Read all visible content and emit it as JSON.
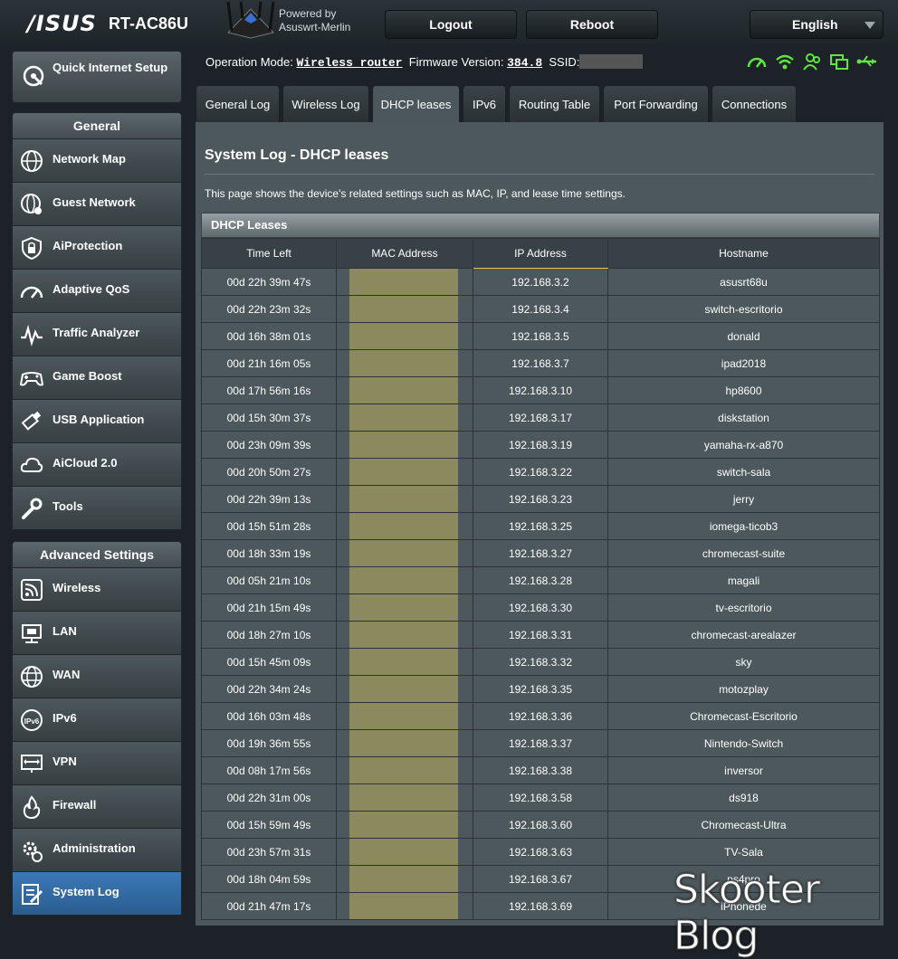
{
  "header": {
    "brand": "/ISUS",
    "model": "RT-AC86U",
    "powered_by": "Powered by",
    "firmware_name": "Asuswrt-Merlin",
    "logout_label": "Logout",
    "reboot_label": "Reboot",
    "language": "English"
  },
  "status": {
    "op_mode_label": "Operation Mode:",
    "op_mode_value": "Wireless router",
    "fw_label": "Firmware Version:",
    "fw_value": "384.8",
    "ssid_label": "SSID:",
    "icons": [
      "speedometer-icon",
      "wifi-icon",
      "users-icon",
      "devices-icon",
      "usb-icon"
    ],
    "icon_color": "#5ee640"
  },
  "sidebar": {
    "quick_setup": "Quick Internet Setup",
    "general_title": "General",
    "general_items": [
      {
        "label": "Network Map",
        "icon": "globe-icon"
      },
      {
        "label": "Guest Network",
        "icon": "guest-network-icon"
      },
      {
        "label": "AiProtection",
        "icon": "lock-shield-icon"
      },
      {
        "label": "Adaptive QoS",
        "icon": "gauge-icon"
      },
      {
        "label": "Traffic Analyzer",
        "icon": "pulse-icon"
      },
      {
        "label": "Game Boost",
        "icon": "gamepad-icon"
      },
      {
        "label": "USB Application",
        "icon": "usb-stick-icon"
      },
      {
        "label": "AiCloud 2.0",
        "icon": "cloud-icon"
      },
      {
        "label": "Tools",
        "icon": "wrench-icon"
      }
    ],
    "advanced_title": "Advanced Settings",
    "advanced_items": [
      {
        "label": "Wireless",
        "icon": "wireless-icon"
      },
      {
        "label": "LAN",
        "icon": "lan-icon"
      },
      {
        "label": "WAN",
        "icon": "wan-globe-icon"
      },
      {
        "label": "IPv6",
        "icon": "ipv6-icon"
      },
      {
        "label": "VPN",
        "icon": "vpn-icon"
      },
      {
        "label": "Firewall",
        "icon": "firewall-icon"
      },
      {
        "label": "Administration",
        "icon": "administration-icon"
      },
      {
        "label": "System Log",
        "icon": "system-log-icon"
      }
    ],
    "active_item": "System Log"
  },
  "tabs": [
    "General Log",
    "Wireless Log",
    "DHCP leases",
    "IPv6",
    "Routing Table",
    "Port Forwarding",
    "Connections"
  ],
  "active_tab": "DHCP leases",
  "page": {
    "title": "System Log - DHCP leases",
    "description": "This page shows the device's related settings such as MAC, IP, and lease time settings.",
    "table_title": "DHCP Leases",
    "columns": [
      "Time Left",
      "MAC Address",
      "IP Address",
      "Hostname"
    ],
    "rows": [
      {
        "time": "00d 22h 39m 47s",
        "ip": "192.168.3.2",
        "host": "asusrt68u"
      },
      {
        "time": "00d 22h 23m 32s",
        "ip": "192.168.3.4",
        "host": "switch-escritorio"
      },
      {
        "time": "00d 16h 38m 01s",
        "ip": "192.168.3.5",
        "host": "donald"
      },
      {
        "time": "00d 21h 16m 05s",
        "ip": "192.168.3.7",
        "host": "ipad2018"
      },
      {
        "time": "00d 17h 56m 16s",
        "ip": "192.168.3.10",
        "host": "hp8600"
      },
      {
        "time": "00d 15h 30m 37s",
        "ip": "192.168.3.17",
        "host": "diskstation"
      },
      {
        "time": "00d 23h 09m 39s",
        "ip": "192.168.3.19",
        "host": "yamaha-rx-a870"
      },
      {
        "time": "00d 20h 50m 27s",
        "ip": "192.168.3.22",
        "host": "switch-sala"
      },
      {
        "time": "00d 22h 39m 13s",
        "ip": "192.168.3.23",
        "host": "jerry"
      },
      {
        "time": "00d 15h 51m 28s",
        "ip": "192.168.3.25",
        "host": "iomega-ticob3"
      },
      {
        "time": "00d 18h 33m 19s",
        "ip": "192.168.3.27",
        "host": "chromecast-suite"
      },
      {
        "time": "00d 05h 21m 10s",
        "ip": "192.168.3.28",
        "host": "magali"
      },
      {
        "time": "00d 21h 15m 49s",
        "ip": "192.168.3.30",
        "host": "tv-escritorio"
      },
      {
        "time": "00d 18h 27m 10s",
        "ip": "192.168.3.31",
        "host": "chromecast-arealazer"
      },
      {
        "time": "00d 15h 45m 09s",
        "ip": "192.168.3.32",
        "host": "sky"
      },
      {
        "time": "00d 22h 34m 24s",
        "ip": "192.168.3.35",
        "host": "motozplay"
      },
      {
        "time": "00d 16h 03m 48s",
        "ip": "192.168.3.36",
        "host": "Chromecast-Escritorio"
      },
      {
        "time": "00d 19h 36m 55s",
        "ip": "192.168.3.37",
        "host": "Nintendo-Switch"
      },
      {
        "time": "00d 08h 17m 56s",
        "ip": "192.168.3.38",
        "host": "inversor"
      },
      {
        "time": "00d 22h 31m 00s",
        "ip": "192.168.3.58",
        "host": "ds918"
      },
      {
        "time": "00d 15h 59m 49s",
        "ip": "192.168.3.60",
        "host": "Chromecast-Ultra"
      },
      {
        "time": "00d 23h 57m 31s",
        "ip": "192.168.3.63",
        "host": "TV-Sala"
      },
      {
        "time": "00d 18h 04m 59s",
        "ip": "192.168.3.67",
        "host": "ps4pro"
      },
      {
        "time": "00d 21h 47m 17s",
        "ip": "192.168.3.69",
        "host": "iPhonede"
      }
    ]
  },
  "watermark": "Skooter Blog"
}
